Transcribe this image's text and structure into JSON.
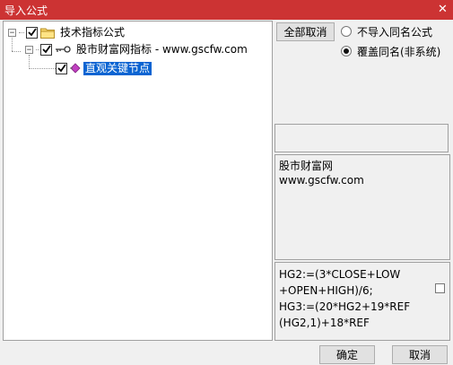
{
  "window": {
    "title": "导入公式",
    "close_glyph": "✕"
  },
  "tree": {
    "root": {
      "label": "技术指标公式",
      "expander": "−",
      "checked": true
    },
    "child": {
      "label": "股市财富网指标 - www.gscfw.com",
      "expander": "−",
      "checked": true
    },
    "leaf": {
      "label": "直观关键节点",
      "checked": true,
      "selected": true
    }
  },
  "controls": {
    "deselect_all_label": "全部取消",
    "options": [
      {
        "label": "不导入同名公式",
        "selected": false
      },
      {
        "label": "覆盖同名(非系统)",
        "selected": true
      }
    ]
  },
  "description": {
    "lines": [
      "股市财富网",
      "www.gscfw.com"
    ]
  },
  "formula": {
    "lines": [
      "HG2:=(3*CLOSE+LOW",
      "+OPEN+HIGH)/6;",
      "HG3:=(20*HG2+19*REF",
      "(HG2,1)+18*REF"
    ]
  },
  "footer": {
    "ok_label": "确定",
    "cancel_label": "取消"
  },
  "colors": {
    "titlebar": "#cc3333",
    "selection": "#0a64d2"
  }
}
